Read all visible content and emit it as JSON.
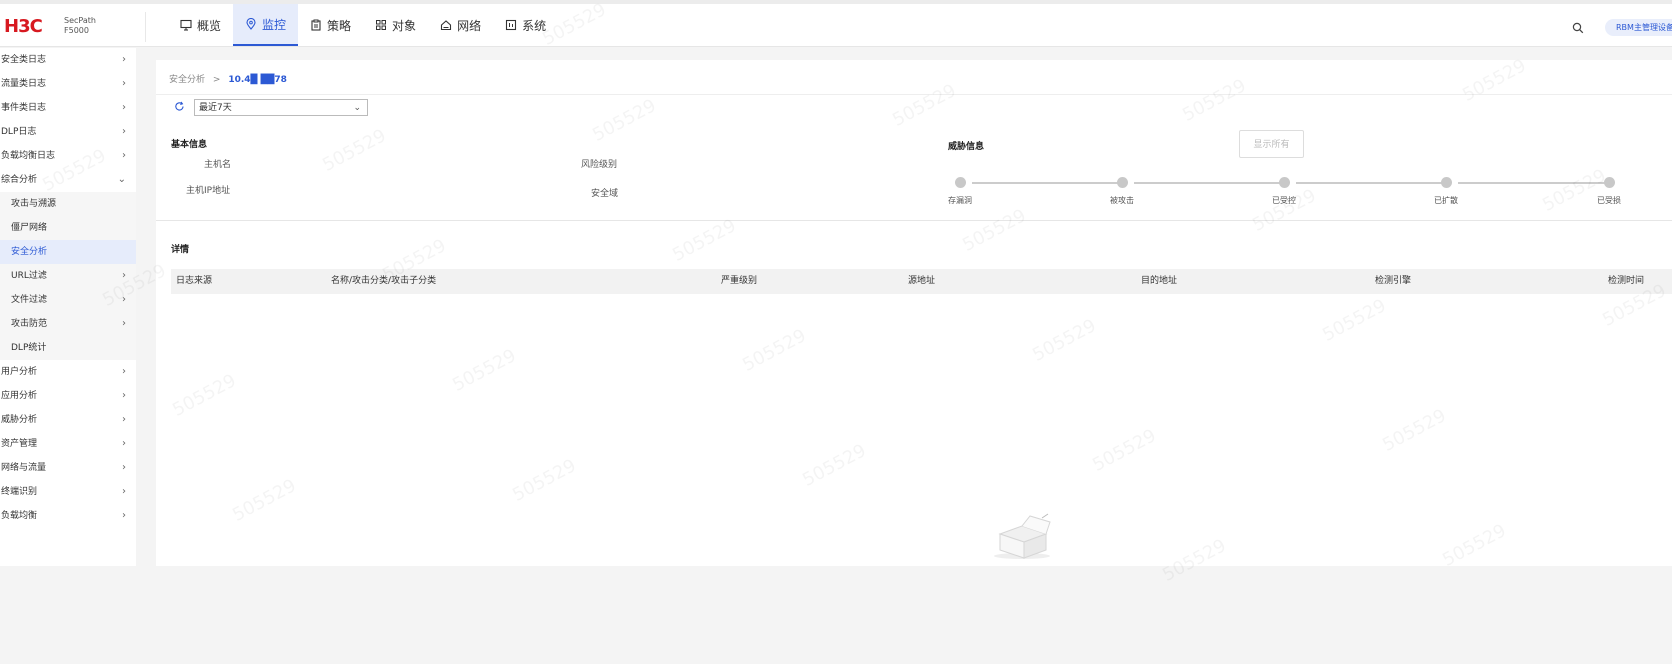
{
  "brand": {
    "logo": "H3C",
    "product_line1": "SecPath",
    "product_line2": "F5000"
  },
  "top_nav": [
    {
      "label": "概览",
      "icon": "monitor-icon"
    },
    {
      "label": "监控",
      "icon": "location-pin-icon",
      "active": true
    },
    {
      "label": "策略",
      "icon": "clipboard-icon"
    },
    {
      "label": "对象",
      "icon": "grid-icon"
    },
    {
      "label": "网络",
      "icon": "house-icon"
    },
    {
      "label": "系统",
      "icon": "window-icon"
    }
  ],
  "user": {
    "label": "RBM主管理设备"
  },
  "sidebar": {
    "items_top": [
      {
        "label": "安全类日志"
      },
      {
        "label": "流量类日志"
      },
      {
        "label": "事件类日志"
      },
      {
        "label": "DLP日志"
      },
      {
        "label": "负载均衡日志"
      },
      {
        "label": "综合分析",
        "expanded": true
      }
    ],
    "sub_items": [
      {
        "label": "攻击与溯源",
        "chevron": false
      },
      {
        "label": "僵尸网络",
        "chevron": false
      },
      {
        "label": "安全分析",
        "chevron": false,
        "active": true
      },
      {
        "label": "URL过滤",
        "chevron": true
      },
      {
        "label": "文件过滤",
        "chevron": true
      },
      {
        "label": "攻击防范",
        "chevron": true
      },
      {
        "label": "DLP统计",
        "chevron": false
      }
    ],
    "items_bottom": [
      {
        "label": "用户分析"
      },
      {
        "label": "应用分析"
      },
      {
        "label": "威胁分析"
      },
      {
        "label": "资产管理"
      },
      {
        "label": "网络与流量"
      },
      {
        "label": "终端识别"
      },
      {
        "label": "负载均衡"
      }
    ]
  },
  "breadcrumb": {
    "parent": "安全分析",
    "separator": ">",
    "current": "10.4█ ██78"
  },
  "time_filter": {
    "value": "最近7天"
  },
  "basic_info": {
    "title": "基本信息",
    "host_name_label": "主机名",
    "host_ip_label": "主机IP地址",
    "risk_level_label": "风险级别",
    "security_domain_label": "安全域"
  },
  "threat_info": {
    "title": "威胁信息",
    "show_all": "显示所有",
    "stages": [
      "存漏洞",
      "被攻击",
      "已受控",
      "已扩散",
      "已受损"
    ]
  },
  "detail": {
    "title": "详情",
    "columns": [
      "日志来源",
      "名称/攻击分类/攻击子分类",
      "严重级别",
      "源地址",
      "目的地址",
      "检测引擎",
      "检测时间"
    ]
  },
  "watermark": "505529"
}
